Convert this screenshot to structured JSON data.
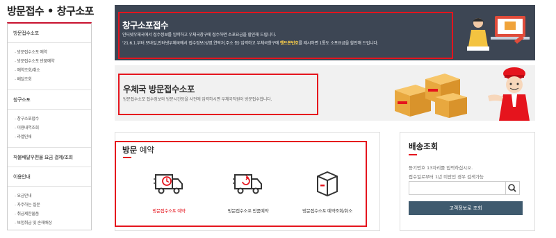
{
  "page_title": "방문접수 • 창구소포",
  "sidebar": {
    "sections": [
      {
        "label": "방문접수소포",
        "items": [
          "방문접수소포 예약",
          "방문접수소포 반품예약",
          "예약조회/취소",
          "배달조회"
        ]
      },
      {
        "label": "창구소포",
        "items": [
          "창구소포접수",
          "이용내역조회",
          "라벨인쇄"
        ]
      },
      {
        "label": "착불배달우편물 요금 결제/조회",
        "items": []
      },
      {
        "label": "이용안내",
        "items": [
          "요금안내",
          "자주하는 질문",
          "취급제한물품",
          "보험취급 및 손해배상"
        ]
      }
    ]
  },
  "banner_counter": {
    "title": "창구소포접수",
    "line1": "인터넷우체국에서 접수정보를 입력하고 우체국창구에 접수하면 소포요금을 할인해 드립니다.",
    "line2_prefix": "'21.6.1.부터 모바일,인터넷우체국에서 접수정보(성명,연락처,주소 등) 입력하고 우체국창구에 ",
    "line2_highlight": "핸드폰번호",
    "line2_suffix": "를 제시하면 1통도 소포요금을 할인해 드립니다."
  },
  "banner_visit": {
    "title": "우체국 방문접수소포",
    "desc": "방문접수소포 접수정보와 방문시간등을 사전에 입력하시면 우체국직원이 방문접수합니다."
  },
  "reservation": {
    "title_bold": "방문",
    "title_rest": " 예약",
    "items": [
      {
        "label": "방문접수소포 예약",
        "icon": "truck-clock-icon"
      },
      {
        "label": "방문접수소포 반품예약",
        "icon": "truck-return-icon"
      },
      {
        "label": "방문접수소포 예약조회/취소",
        "icon": "package-box-icon"
      }
    ]
  },
  "tracking": {
    "title": "배송조회",
    "desc1": "등기번호 13자리를 입력하십시오.",
    "desc2": "접수일로부터 1년 미만인 경우 검색가능",
    "input_value": "",
    "button": "고객정보로 조회"
  },
  "colors": {
    "accent_red": "#e5141d",
    "banner_dark": "#3d4654",
    "button_blue": "#3f5a6e",
    "highlight_yellow": "#ffd24a"
  }
}
